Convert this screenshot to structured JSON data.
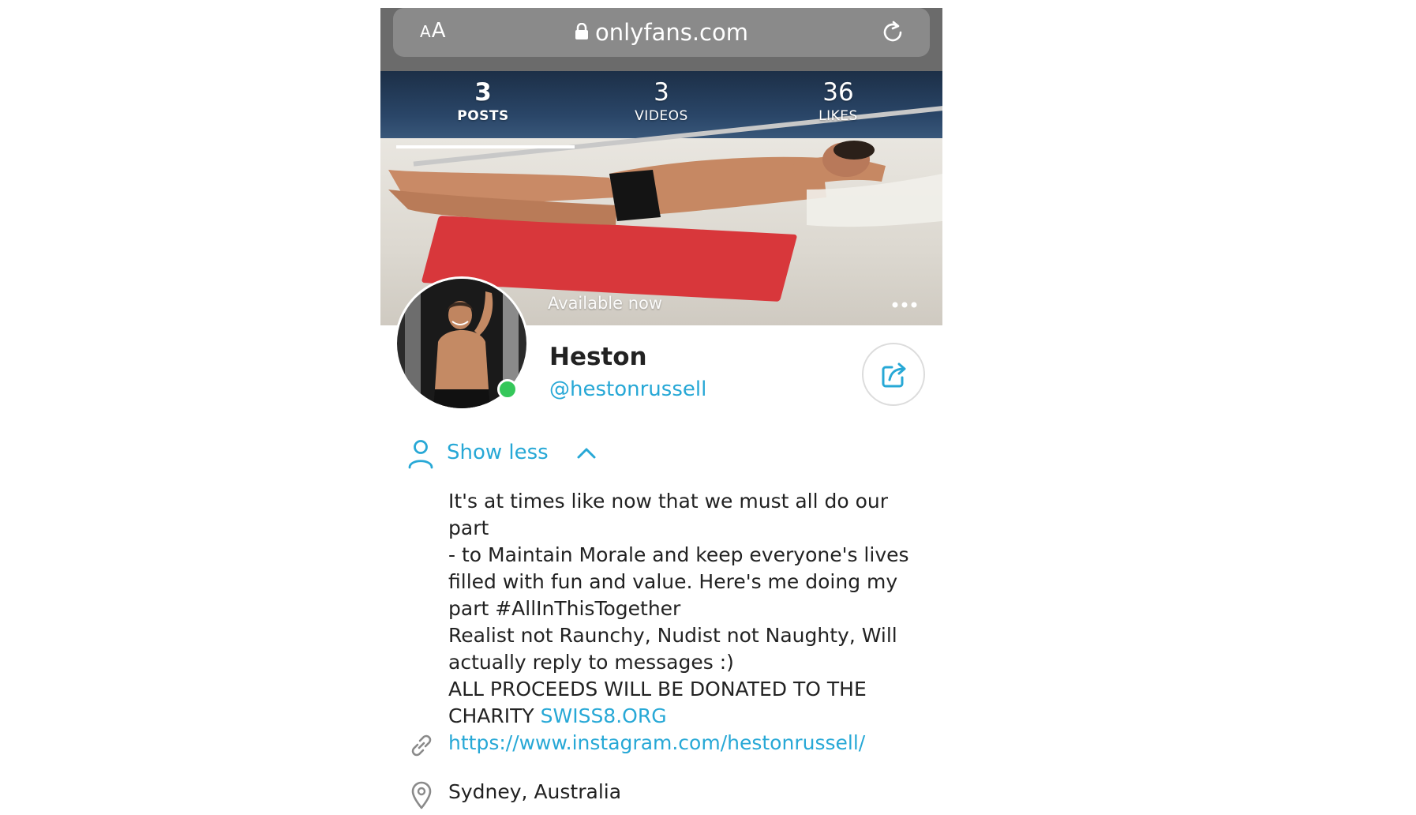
{
  "browser": {
    "text_size_label": "AA",
    "url": "onlyfans.com"
  },
  "stats": [
    {
      "value": "3",
      "label": "POSTS",
      "active": true
    },
    {
      "value": "3",
      "label": "VIDEOS",
      "active": false
    },
    {
      "value": "36",
      "label": "LIKES",
      "active": false
    }
  ],
  "cover": {
    "status_text": "Available now"
  },
  "profile": {
    "display_name": "Heston",
    "username": "@hestonrussell",
    "online": true
  },
  "about": {
    "toggle_label": "Show less",
    "bio_lines": [
      "It's at times like now that we must all do our part",
      "- to Maintain Morale and keep everyone's lives",
      "filled with fun and value. Here's me doing my",
      "part #AllInThisTogether",
      "Realist not Raunchy, Nudist not Naughty, Will",
      "actually reply to messages :)",
      "ALL PROCEEDS WILL BE DONATED TO THE"
    ],
    "charity_prefix": "CHARITY",
    "charity_link": "SWISS8.ORG",
    "website": "https://www.instagram.com/hestonrussell/",
    "location": "Sydney, Australia"
  },
  "colors": {
    "accent": "#27a8d6",
    "online": "#35c75a",
    "text": "#222222",
    "browser_bar": "#6b6b6b"
  },
  "icons": {
    "lock": "lock-icon",
    "reload": "reload-icon",
    "more": "more-icon",
    "share": "share-icon",
    "user": "user-icon",
    "chevron": "chevron-up-icon",
    "link": "link-icon",
    "location": "location-pin-icon"
  }
}
